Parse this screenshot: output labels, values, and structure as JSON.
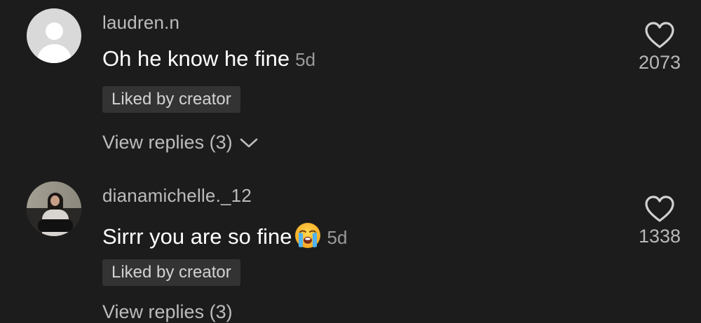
{
  "comments": [
    {
      "username": "laudren.n",
      "text": "Oh he know he fine",
      "emoji": "",
      "time": "5d",
      "badge": "Liked by creator",
      "like_count": "2073",
      "view_replies": "View replies (3)",
      "avatar": "default-avatar-icon"
    },
    {
      "username": "dianamichelle._12",
      "text": "Sirrr you are so fine",
      "emoji": "loudly-crying-face-emoji",
      "time": "5d",
      "badge": "Liked by creator",
      "like_count": "1338",
      "view_replies": "View replies (3)",
      "avatar": "profile-photo"
    }
  ],
  "colors": {
    "background": "#1c1c1c",
    "username": "#bcbcbc",
    "text": "#ffffff",
    "badge_bg": "#333333",
    "badge_text": "#d2d2d2",
    "timestamp": "#9a9a9a"
  }
}
